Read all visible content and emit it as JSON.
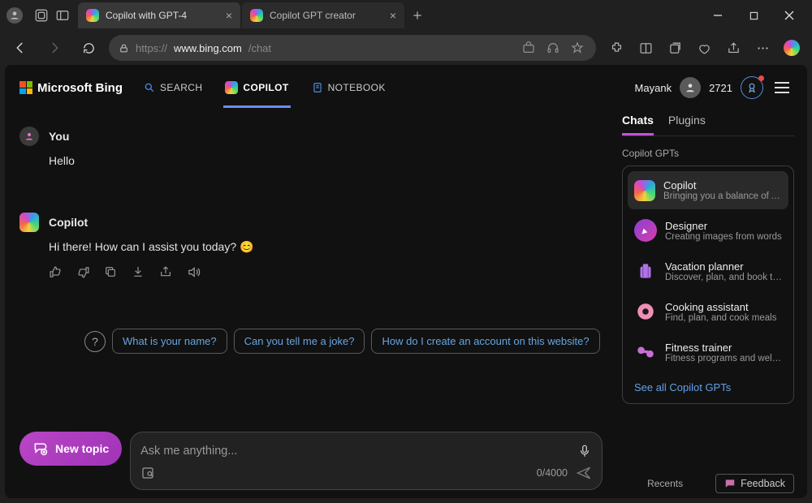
{
  "titlebar": {
    "tabs": [
      {
        "title": "Copilot with GPT-4"
      },
      {
        "title": "Copilot GPT creator"
      }
    ]
  },
  "address": {
    "protocol": "https://",
    "host": "www.bing.com",
    "path": "/chat"
  },
  "bing": {
    "logo_text": "Microsoft Bing",
    "nav_search": "SEARCH",
    "nav_copilot": "COPILOT",
    "nav_notebook": "NOTEBOOK",
    "user_name": "Mayank",
    "points": "2721"
  },
  "chat": {
    "user_label": "You",
    "user_msg": "Hello",
    "bot_label": "Copilot",
    "bot_msg": "Hi there! How can I assist you today? 😊",
    "suggestions": [
      "What is your name?",
      "Can you tell me a joke?",
      "How do I create an account on this website?"
    ],
    "new_topic": "New topic",
    "placeholder": "Ask me anything...",
    "counter": "0/4000"
  },
  "side": {
    "tab_chats": "Chats",
    "tab_plugins": "Plugins",
    "section_label": "Copilot GPTs",
    "gpts": [
      {
        "name": "Copilot",
        "desc": "Bringing you a balance of AI a"
      },
      {
        "name": "Designer",
        "desc": "Creating images from words"
      },
      {
        "name": "Vacation planner",
        "desc": "Discover, plan, and book trave"
      },
      {
        "name": "Cooking assistant",
        "desc": "Find, plan, and cook meals"
      },
      {
        "name": "Fitness trainer",
        "desc": "Fitness programs and wellne"
      }
    ],
    "see_all": "See all Copilot GPTs",
    "recents": "Recents",
    "feedback": "Feedback"
  }
}
